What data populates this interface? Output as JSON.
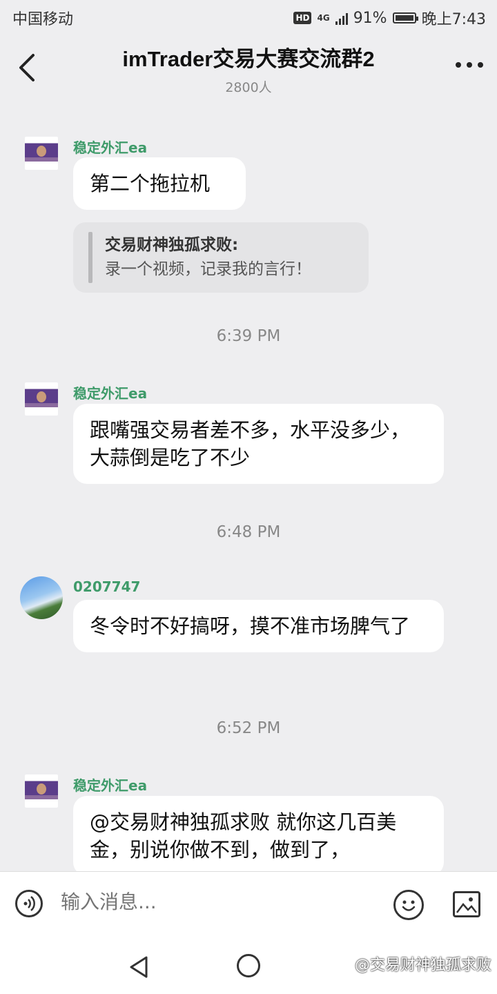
{
  "status_bar": {
    "carrier": "中国移动",
    "hd": "HD",
    "network": "4G",
    "battery": "91%",
    "time": "晚上7:43"
  },
  "header": {
    "title": "imTrader交易大赛交流群2",
    "member_count": "2800人"
  },
  "messages": [
    {
      "sender": "稳定外汇ea",
      "text": "第二个拖拉机",
      "quote_name": "交易财神独孤求败:",
      "quote_text": "录一个视频，记录我的言行！"
    },
    {
      "time": "6:39 PM"
    },
    {
      "sender": "稳定外汇ea",
      "text": "跟嘴强交易者差不多，水平没多少，大蒜倒是吃了不少"
    },
    {
      "time": "6:48 PM"
    },
    {
      "sender": "0207747",
      "text": "冬令时不好搞呀，摸不准市场脾气了"
    },
    {
      "time": "6:52 PM"
    },
    {
      "sender": "稳定外汇ea",
      "text": "@交易财神独孤求败 就你这几百美金，别说你做不到，做到了，"
    }
  ],
  "input": {
    "placeholder": "输入消息..."
  },
  "watermark": "@交易财神独孤求败",
  "icons": {
    "back": "back-arrow-icon",
    "more": "more-dots-icon",
    "voice": "voice-icon",
    "emoji": "emoji-icon",
    "image": "image-icon"
  },
  "colors": {
    "sender": "#3f9b6a",
    "background": "#eeeef0",
    "bubble": "#ffffff"
  }
}
